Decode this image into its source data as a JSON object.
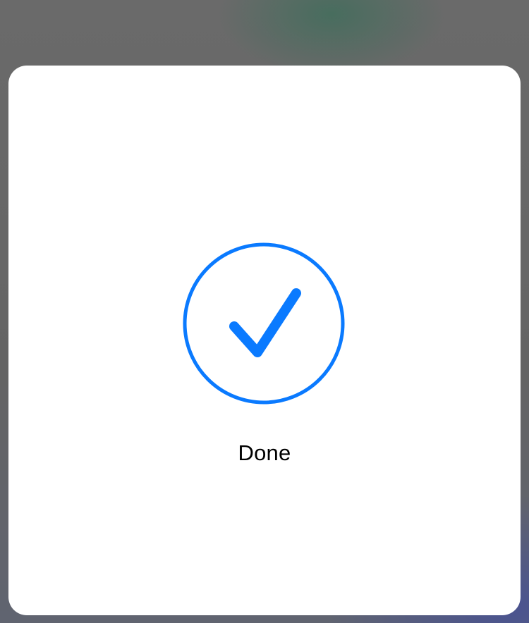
{
  "dialog": {
    "status_text": "Done",
    "icon": "checkmark-circle-icon"
  },
  "colors": {
    "accent": "#0A7AFF",
    "card_background": "#FFFFFF",
    "text": "#000000"
  }
}
